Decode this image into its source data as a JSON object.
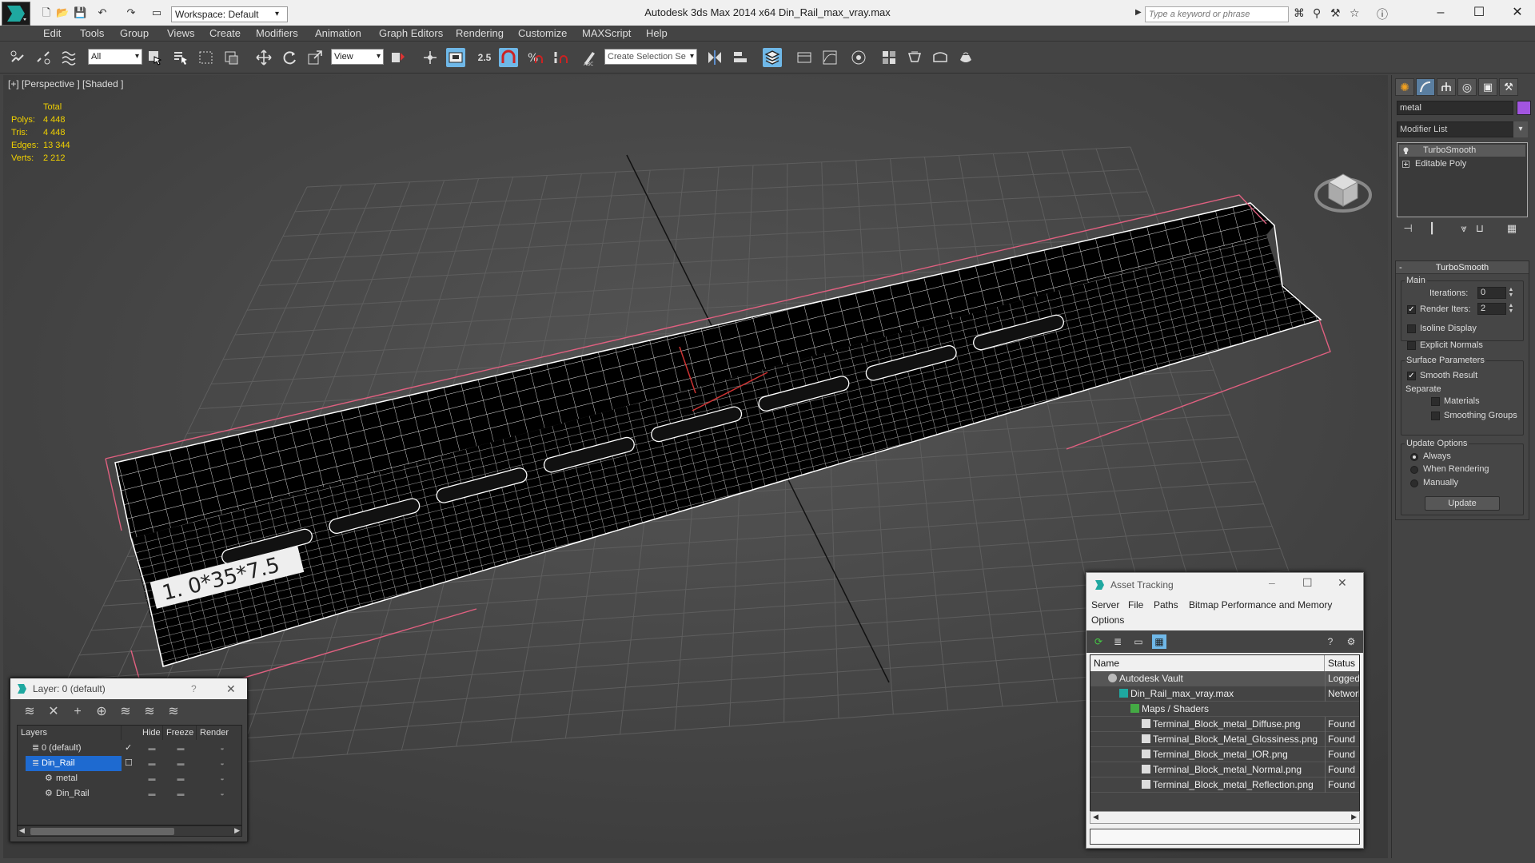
{
  "titlebar": {
    "workspace": "Workspace: Default",
    "title": "Autodesk 3ds Max  2014 x64      Din_Rail_max_vray.max",
    "search_placeholder": "Type a keyword or phrase"
  },
  "menu": [
    "Edit",
    "Tools",
    "Group",
    "Views",
    "Create",
    "Modifiers",
    "Animation",
    "Graph Editors",
    "Rendering",
    "Customize",
    "MAXScript",
    "Help"
  ],
  "toolbar": {
    "selection_filter": "All",
    "ref_coord": "View",
    "snap_angle": "2.5",
    "named_selection": "Create Selection Se"
  },
  "viewport": {
    "label": "[+] [Perspective ] [Shaded ]",
    "stats": {
      "header": "Total",
      "rows": [
        {
          "label": "Polys:",
          "value": "4 448"
        },
        {
          "label": "Tris:",
          "value": "4 448"
        },
        {
          "label": "Edges:",
          "value": "13 344"
        },
        {
          "label": "Verts:",
          "value": "2 212"
        }
      ]
    },
    "rail_label": "1. 0*35*7.5"
  },
  "command_panel": {
    "object_name": "metal",
    "object_color": "#a255e0",
    "modifier_list": "Modifier List",
    "stack": [
      "TurboSmooth",
      "Editable Poly"
    ],
    "rollout": {
      "title": "TurboSmooth",
      "main_group": "Main",
      "iterations_label": "Iterations:",
      "iterations_value": "0",
      "render_iters_label": "Render Iters:",
      "render_iters_value": "2",
      "isoline": "Isoline Display",
      "explicit_normals": "Explicit Normals",
      "surface_group": "Surface Parameters",
      "smooth_result": "Smooth Result",
      "separate": "Separate",
      "materials": "Materials",
      "smoothing_groups": "Smoothing Groups",
      "update_group": "Update Options",
      "always": "Always",
      "when_rendering": "When Rendering",
      "manually": "Manually",
      "update_button": "Update"
    }
  },
  "layer_dialog": {
    "title": "Layer: 0 (default)",
    "help": "?",
    "columns": [
      "Layers",
      "Hide",
      "Freeze",
      "Render"
    ],
    "rows": [
      {
        "name": "0 (default)"
      },
      {
        "name": "Din_Rail"
      },
      {
        "name": "metal"
      },
      {
        "name": "Din_Rail"
      }
    ]
  },
  "asset_tracking": {
    "title": "Asset Tracking",
    "menu": [
      "Server",
      "File",
      "Paths",
      "Bitmap Performance and Memory",
      "Options"
    ],
    "columns": [
      "Name",
      "Status"
    ],
    "rows": [
      {
        "name": "Autodesk Vault",
        "status": "Logged"
      },
      {
        "name": "Din_Rail_max_vray.max",
        "status": "Network"
      },
      {
        "name": "Maps / Shaders",
        "status": ""
      },
      {
        "name": "Terminal_Block_metal_Diffuse.png",
        "status": "Found"
      },
      {
        "name": "Terminal_Block_Metal_Glossiness.png",
        "status": "Found"
      },
      {
        "name": "Terminal_Block_metal_IOR.png",
        "status": "Found"
      },
      {
        "name": "Terminal_Block_metal_Normal.png",
        "status": "Found"
      },
      {
        "name": "Terminal_Block_metal_Reflection.png",
        "status": "Found"
      }
    ]
  }
}
